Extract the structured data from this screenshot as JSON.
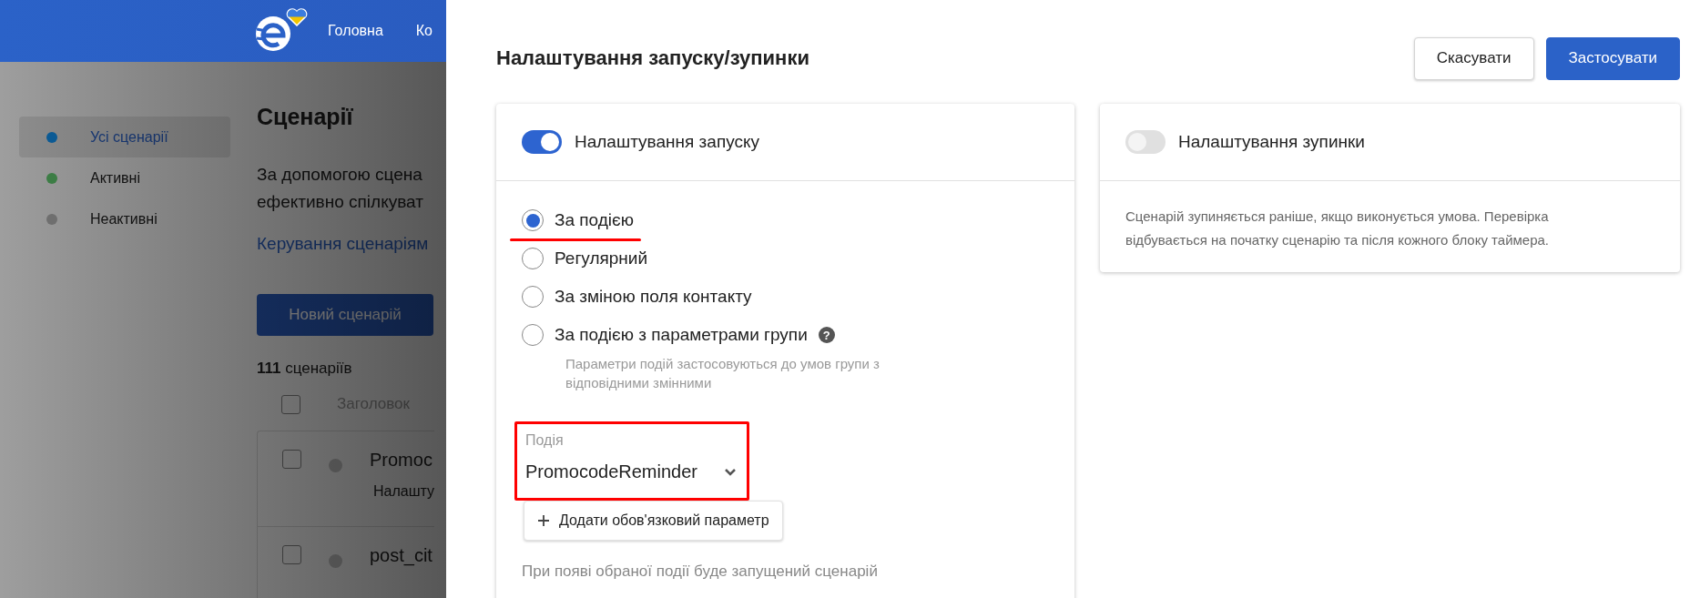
{
  "nav": {
    "items": [
      "Головна",
      "Ко"
    ]
  },
  "sidebar": {
    "items": [
      {
        "label": "Усі сценарії",
        "color": "#0b5a94",
        "selected": true
      },
      {
        "label": "Активні",
        "color": "#3c7d45",
        "selected": false
      },
      {
        "label": "Неактивні",
        "color": "#6f6f6f",
        "selected": false
      }
    ]
  },
  "page": {
    "title": "Сценарії",
    "description": [
      "За допомогою сцена",
      "ефективно спілкуват"
    ],
    "link": "Керування сценаріям",
    "new_button": "Новий сценарій",
    "count_number": "111",
    "count_label": "сценаріїв",
    "table": {
      "header": "Заголовок",
      "header_checked": false,
      "rows": [
        {
          "title": "Promoc",
          "subtitle": "Налашту",
          "checked": false
        },
        {
          "title": "post_cit",
          "checked": false
        }
      ]
    }
  },
  "panel": {
    "title": "Налаштування запуску/зупинки",
    "buttons": [
      {
        "label": "Скасувати",
        "kind": "secondary"
      },
      {
        "label": "Застосувати",
        "kind": "primary"
      }
    ],
    "start": {
      "title": "Налаштування запуску",
      "on": true,
      "options": [
        {
          "label": "За подією",
          "selected": true,
          "highlighted": true
        },
        {
          "label": "Регулярний",
          "selected": false,
          "highlighted": false
        },
        {
          "label": "За зміною поля контакту",
          "selected": false,
          "highlighted": false
        },
        {
          "label": "За подією з параметрами групи",
          "selected": false,
          "highlighted": false,
          "help": "?",
          "hint": "Параметри подій застосовуються до умов групи з відповідними змінними"
        }
      ],
      "field": {
        "label": "Подія",
        "value": "PromocodeReminder",
        "highlighted": true
      },
      "add_button": "Додати обов'язковий параметр",
      "caption": "При появі обраної події буде запущений сценарій"
    },
    "stop": {
      "title": "Налаштування зупинки",
      "on": false,
      "description": "Сценарій зупиняється раніше, якщо виконується умова. Перевірка відбувається на початку сценарію та після кожного блоку таймера."
    }
  }
}
